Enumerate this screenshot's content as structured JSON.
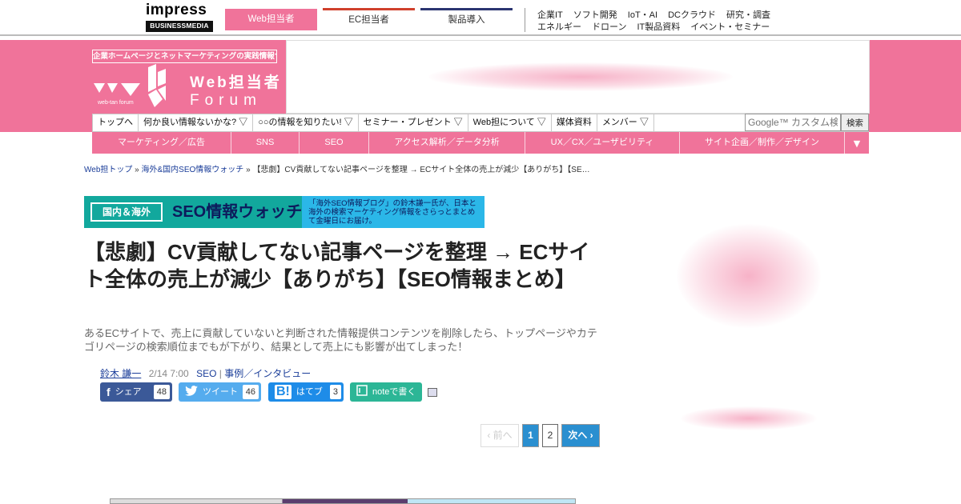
{
  "topbar": {
    "logo_line1": "impress",
    "logo_line2": "BUSINESSMEDIA",
    "tabs": [
      "Web担当者",
      "EC担当者",
      "製品導入"
    ],
    "links_row1": [
      "企業IT",
      "ソフト開発",
      "IoT・AI",
      "DCクラウド",
      "研究・調査"
    ],
    "links_row2": [
      "エネルギー",
      "ドローン",
      "IT製品資料",
      "イベント・セミナー"
    ]
  },
  "header": {
    "tagline": "企業ホームページとネットマーケティングの実践情報サイト",
    "logo_title": "Web担当者",
    "logo_sub": "Forum",
    "logo_small": "web-tan forum"
  },
  "nav": {
    "items": [
      "トップへ",
      "何か良い情報ないかな? ▽",
      "○○の情報を知りたい! ▽",
      "セミナー・プレゼント ▽",
      "Web担について ▽",
      "媒体資料",
      "メンバー ▽"
    ],
    "search_placeholder": "Google™ カスタム検索",
    "search_button": "検索"
  },
  "categories": {
    "items": [
      "マーケティング／広告",
      "SNS",
      "SEO",
      "アクセス解析／データ分析",
      "UX／CX／ユーザビリティ",
      "サイト企画／制作／デザイン"
    ],
    "arrow": "▼"
  },
  "breadcrumb": {
    "home": "Web担トップ",
    "sep": " » ",
    "section": "海外&国内SEO情報ウォッチ",
    "current": "【悲劇】CV貢献してない記事ページを整理 → ECサイト全体の売上が減少【ありがち】【SE…"
  },
  "banner": {
    "label1": "国内＆海外",
    "label2": "SEO情報ウォッチ",
    "desc": "「海外SEO情報ブログ」の鈴木謙一氏が、日本と海外の検索マーケティング情報をさらっとまとめて金曜日にお届け。"
  },
  "article": {
    "title": "【悲劇】CV貢献してない記事ページを整理 → ECサイト全体の売上が減少【ありがち】【SEO情報まとめ】",
    "lead": "あるECサイトで、売上に貢献していないと判断された情報提供コンテンツを削除したら、トップページやカテゴリページの検索順位までもが下がり、結果として売上にも影響が出てしまった！",
    "author": "鈴木 謙一",
    "date": "2/14 7:00",
    "tag1": "SEO",
    "tag_sep": " | ",
    "tag2": "事例／インタビュー"
  },
  "share": {
    "facebook_label": "シェア",
    "facebook_count": "48",
    "twitter_label": "ツイート",
    "twitter_count": "46",
    "hatena_label": "はてブ",
    "hatena_count": "3",
    "note_label": "noteで書く"
  },
  "pager": {
    "prev": "‹ 前へ",
    "page1": "1",
    "page2": "2",
    "next": "次へ ›"
  },
  "colors": {
    "brand_pink": "#f0739a",
    "link_blue": "#1a3d99",
    "pager_blue": "#2a8fd0"
  }
}
